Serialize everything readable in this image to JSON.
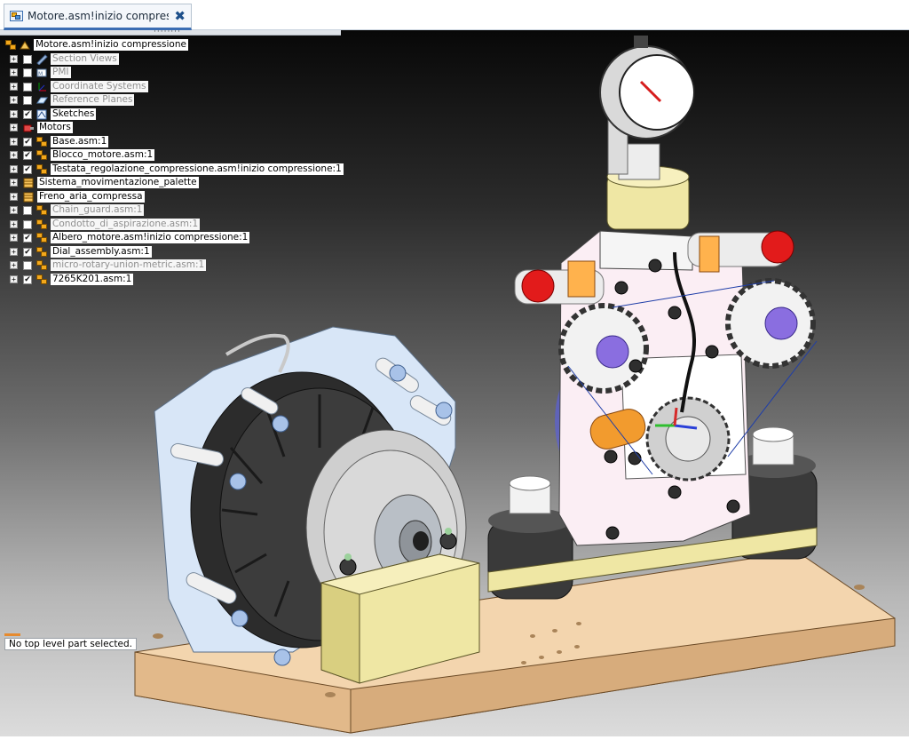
{
  "tab": {
    "title": "Motore.asm!inizio compres...",
    "close": "✖"
  },
  "tree": {
    "root": "Motore.asm!inizio compressione",
    "items": [
      {
        "label": "Section Views",
        "checked": false,
        "dim": true,
        "icon": "section-views-icon"
      },
      {
        "label": "PMI",
        "checked": false,
        "dim": true,
        "icon": "pmi-icon"
      },
      {
        "label": "Coordinate Systems",
        "checked": false,
        "dim": true,
        "icon": "coordinate-systems-icon"
      },
      {
        "label": "Reference Planes",
        "checked": false,
        "dim": true,
        "icon": "reference-planes-icon"
      },
      {
        "label": "Sketches",
        "checked": true,
        "dim": false,
        "icon": "sketches-icon"
      },
      {
        "label": "Motors",
        "checked": null,
        "dim": false,
        "icon": "motors-icon"
      },
      {
        "label": "Base.asm:1",
        "checked": true,
        "dim": false,
        "icon": "assembly-icon"
      },
      {
        "label": "Blocco_motore.asm:1",
        "checked": true,
        "dim": false,
        "icon": "assembly-icon"
      },
      {
        "label": "Testata_regolazione_compressione.asm!inizio compressione:1",
        "checked": true,
        "dim": false,
        "icon": "assembly-icon"
      },
      {
        "label": "Sistema_movimentazione_palette",
        "checked": null,
        "dim": false,
        "icon": "group-icon"
      },
      {
        "label": "Freno_aria_compressa",
        "checked": null,
        "dim": false,
        "icon": "group-icon"
      },
      {
        "label": "Chain_guard.asm:1",
        "checked": false,
        "dim": true,
        "icon": "assembly-icon"
      },
      {
        "label": "Condotto_di_aspirazione.asm:1",
        "checked": false,
        "dim": true,
        "icon": "assembly-icon"
      },
      {
        "label": "Albero_motore.asm!inizio compressione:1",
        "checked": true,
        "dim": false,
        "icon": "assembly-icon"
      },
      {
        "label": "Dial_assembly.asm:1",
        "checked": true,
        "dim": false,
        "icon": "assembly-icon"
      },
      {
        "label": "micro-rotary-union-metric.asm:1",
        "checked": false,
        "dim": true,
        "icon": "assembly-icon"
      },
      {
        "label": "7265K201.asm:1",
        "checked": true,
        "dim": false,
        "icon": "assembly-icon"
      }
    ]
  },
  "status": "No top level part selected.",
  "colors": {
    "accent": "#3b6db3",
    "status_bar": "#e68a2e",
    "base_plate": "#f1d3ac"
  }
}
